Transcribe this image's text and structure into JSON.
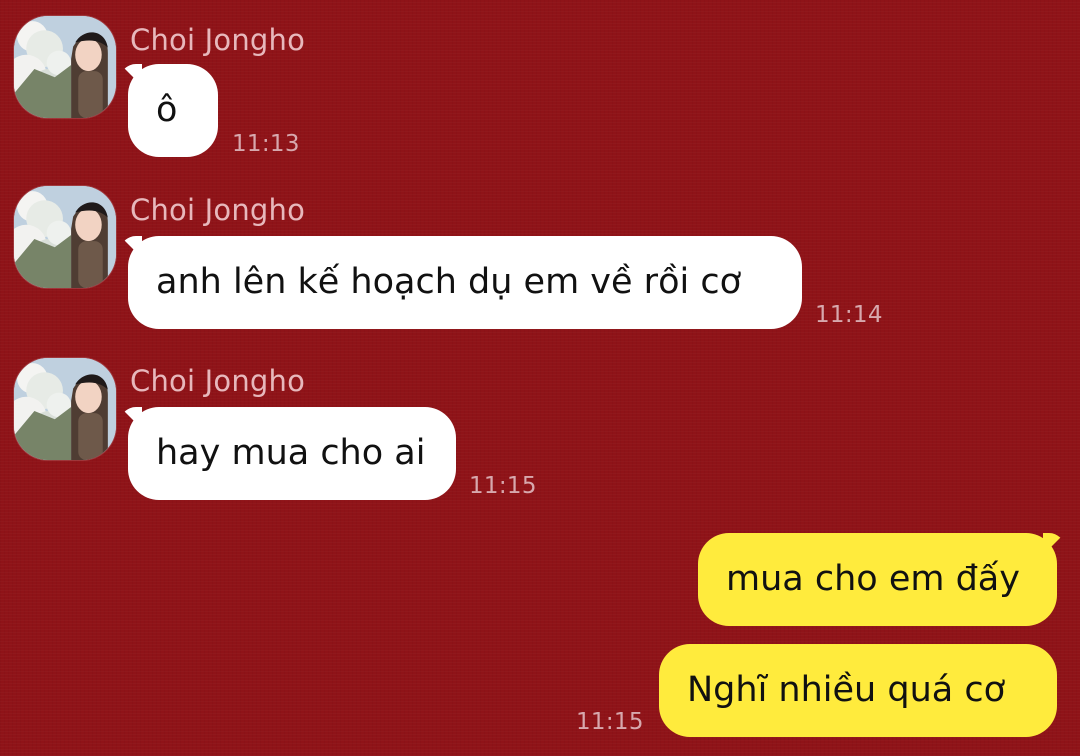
{
  "messages": [
    {
      "sender": "Choi Jongho",
      "text": "ô",
      "time": "11:13"
    },
    {
      "sender": "Choi Jongho",
      "text": "anh lên kế hoạch dụ em về rồi cơ",
      "time": "11:14"
    },
    {
      "sender": "Choi Jongho",
      "text": "hay mua cho ai",
      "time": "11:15"
    },
    {
      "sender": "",
      "text": "mua cho em đấy",
      "time": ""
    },
    {
      "sender": "",
      "text": "Nghĩ nhiều quá cơ",
      "time": "11:15"
    }
  ],
  "colors": {
    "background": "#8f1318",
    "incoming_bubble": "#ffffff",
    "outgoing_bubble": "#ffeb3d",
    "name_text": "#e7b8bc",
    "time_text": "#d7a8ad"
  },
  "icons": {
    "avatar": "avatar-image"
  }
}
